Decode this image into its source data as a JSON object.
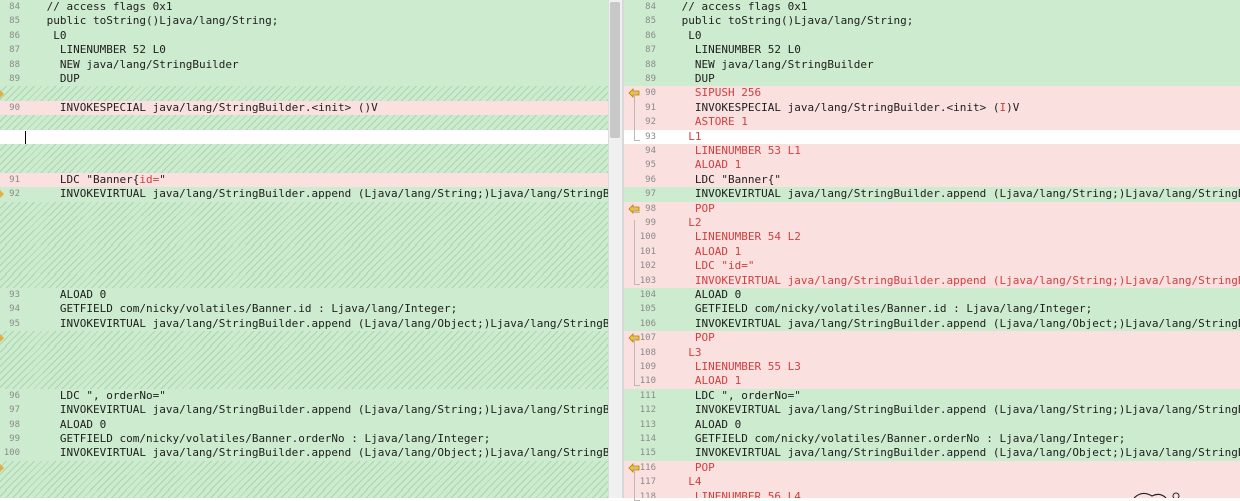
{
  "left": {
    "lines": [
      {
        "num": "84",
        "text": " // access flags 0x1",
        "bg": "g"
      },
      {
        "num": "85",
        "text": " public toString()Ljava/lang/String;",
        "bg": "g"
      },
      {
        "num": "86",
        "text": "  L0",
        "bg": "g"
      },
      {
        "num": "87",
        "text": "   LINENUMBER 52 L0",
        "bg": "g"
      },
      {
        "num": "88",
        "text": "   NEW java/lang/StringBuilder",
        "bg": "g"
      },
      {
        "num": "89",
        "text": "   DUP",
        "bg": "g"
      },
      {
        "num": "",
        "text": "",
        "bg": "h"
      },
      {
        "num": "90",
        "text": "   INVOKESPECIAL java/lang/StringBuilder.<init> ()V",
        "bg": "r",
        "plain": true
      },
      {
        "num": "",
        "text": "",
        "bg": "h"
      },
      {
        "num": "",
        "text": "",
        "bg": "w"
      },
      {
        "num": "",
        "text": "",
        "bg": "h"
      },
      {
        "num": "",
        "text": "",
        "bg": "h"
      },
      {
        "num": "91",
        "text": "   LDC \"Banner{",
        "hl": "id=",
        "tail": "\"",
        "bg": "r",
        "plain": true
      },
      {
        "num": "92",
        "text": "   INVOKEVIRTUAL java/lang/StringBuilder.append (Ljava/lang/String;)Ljava/lang/StringBuilder;",
        "bg": "g"
      },
      {
        "num": "",
        "text": "",
        "bg": "h"
      },
      {
        "num": "",
        "text": "",
        "bg": "h"
      },
      {
        "num": "",
        "text": "",
        "bg": "h"
      },
      {
        "num": "",
        "text": "",
        "bg": "h"
      },
      {
        "num": "",
        "text": "",
        "bg": "h"
      },
      {
        "num": "",
        "text": "",
        "bg": "h"
      },
      {
        "num": "93",
        "text": "   ALOAD 0",
        "bg": "g"
      },
      {
        "num": "94",
        "text": "   GETFIELD com/nicky/volatiles/Banner.id : Ljava/lang/Integer;",
        "bg": "g"
      },
      {
        "num": "95",
        "text": "   INVOKEVIRTUAL java/lang/StringBuilder.append (Ljava/lang/Object;)Ljava/lang/StringBuilder;",
        "bg": "g"
      },
      {
        "num": "",
        "text": "",
        "bg": "h"
      },
      {
        "num": "",
        "text": "",
        "bg": "h"
      },
      {
        "num": "",
        "text": "",
        "bg": "h"
      },
      {
        "num": "",
        "text": "",
        "bg": "h"
      },
      {
        "num": "96",
        "text": "   LDC \", orderNo=\"",
        "bg": "g"
      },
      {
        "num": "97",
        "text": "   INVOKEVIRTUAL java/lang/StringBuilder.append (Ljava/lang/String;)Ljava/lang/StringBuilder;",
        "bg": "g"
      },
      {
        "num": "98",
        "text": "   ALOAD 0",
        "bg": "g"
      },
      {
        "num": "99",
        "text": "   GETFIELD com/nicky/volatiles/Banner.orderNo : Ljava/lang/Integer;",
        "bg": "g"
      },
      {
        "num": "100",
        "text": "   INVOKEVIRTUAL java/lang/StringBuilder.append (Ljava/lang/Object;)Ljava/lang/StringBuilder;",
        "bg": "g"
      },
      {
        "num": "",
        "text": "",
        "bg": "h"
      },
      {
        "num": "",
        "text": "",
        "bg": "h"
      },
      {
        "num": "",
        "text": "",
        "bg": "h"
      }
    ]
  },
  "right": {
    "lines": [
      {
        "num": "84",
        "text": " // access flags 0x1",
        "bg": "g"
      },
      {
        "num": "85",
        "text": " public toString()Ljava/lang/String;",
        "bg": "g"
      },
      {
        "num": "86",
        "text": "  L0",
        "bg": "g"
      },
      {
        "num": "87",
        "text": "   LINENUMBER 52 L0",
        "bg": "g"
      },
      {
        "num": "88",
        "text": "   NEW java/lang/StringBuilder",
        "bg": "g"
      },
      {
        "num": "89",
        "text": "   DUP",
        "bg": "g"
      },
      {
        "num": "90",
        "text": "   SIPUSH 256",
        "bg": "r",
        "arrow": true
      },
      {
        "num": "91",
        "text": "   INVOKESPECIAL java/lang/StringBuilder.<init> (",
        "hl": "I",
        "tail": ")V",
        "bg": "r",
        "plain": true
      },
      {
        "num": "92",
        "text": "   ASTORE 1",
        "bg": "r"
      },
      {
        "num": "93",
        "text": "  L1",
        "bg": "w",
        "red": true
      },
      {
        "num": "94",
        "text": "   LINENUMBER 53 L1",
        "bg": "r"
      },
      {
        "num": "95",
        "text": "   ALOAD 1",
        "bg": "r"
      },
      {
        "num": "96",
        "text": "   LDC \"Banner{\"",
        "bg": "r",
        "plain": true
      },
      {
        "num": "97",
        "text": "   INVOKEVIRTUAL java/lang/StringBuilder.append (Ljava/lang/String;)Ljava/lang/StringBuilder;",
        "bg": "g"
      },
      {
        "num": "98",
        "text": "   POP",
        "bg": "r",
        "arrow": true
      },
      {
        "num": "99",
        "text": "  L2",
        "bg": "r"
      },
      {
        "num": "100",
        "text": "   LINENUMBER 54 L2",
        "bg": "r"
      },
      {
        "num": "101",
        "text": "   ALOAD 1",
        "bg": "r"
      },
      {
        "num": "102",
        "text": "   LDC \"id=\"",
        "bg": "r"
      },
      {
        "num": "103",
        "text": "   INVOKEVIRTUAL java/lang/StringBuilder.append (Ljava/lang/String;)Ljava/lang/StringBuilder;",
        "bg": "r"
      },
      {
        "num": "104",
        "text": "   ALOAD 0",
        "bg": "g"
      },
      {
        "num": "105",
        "text": "   GETFIELD com/nicky/volatiles/Banner.id : Ljava/lang/Integer;",
        "bg": "g"
      },
      {
        "num": "106",
        "text": "   INVOKEVIRTUAL java/lang/StringBuilder.append (Ljava/lang/Object;)Ljava/lang/StringBuilder;",
        "bg": "g"
      },
      {
        "num": "107",
        "text": "   POP",
        "bg": "r",
        "arrow": true
      },
      {
        "num": "108",
        "text": "  L3",
        "bg": "r"
      },
      {
        "num": "109",
        "text": "   LINENUMBER 55 L3",
        "bg": "r"
      },
      {
        "num": "110",
        "text": "   ALOAD 1",
        "bg": "r"
      },
      {
        "num": "111",
        "text": "   LDC \", orderNo=\"",
        "bg": "g"
      },
      {
        "num": "112",
        "text": "   INVOKEVIRTUAL java/lang/StringBuilder.append (Ljava/lang/String;)Ljava/lang/StringBuilder;",
        "bg": "g"
      },
      {
        "num": "113",
        "text": "   ALOAD 0",
        "bg": "g"
      },
      {
        "num": "114",
        "text": "   GETFIELD com/nicky/volatiles/Banner.orderNo : Ljava/lang/Integer;",
        "bg": "g"
      },
      {
        "num": "115",
        "text": "   INVOKEVIRTUAL java/lang/StringBuilder.append (Ljava/lang/Object;)Ljava/lang/StringBuilder;",
        "bg": "g"
      },
      {
        "num": "116",
        "text": "   POP",
        "bg": "r",
        "arrow": true
      },
      {
        "num": "117",
        "text": "  L4",
        "bg": "r"
      },
      {
        "num": "118",
        "text": "   LINENUMBER 56 L4",
        "bg": "r"
      }
    ]
  },
  "colors": {
    "added": "#cdeccf",
    "changed": "#fbe0e0",
    "changed_text": "#d04040",
    "gutter": "#f4f4f4"
  },
  "icons": {
    "arrow": "left-arrow-icon",
    "left_marker": "diff-marker-icon"
  }
}
